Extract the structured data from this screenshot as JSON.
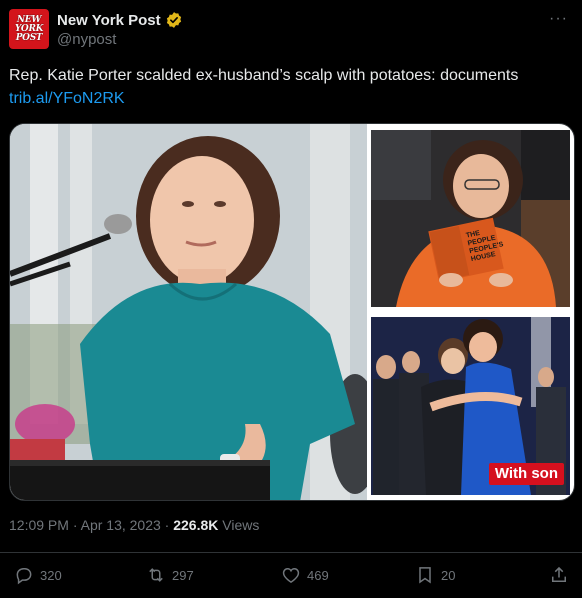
{
  "account": {
    "name": "New York Post",
    "handle": "@nypost",
    "avatar_lines": [
      "NEW",
      "YORK",
      "POST"
    ],
    "verified_color": "#e2b719"
  },
  "tweet": {
    "text": "Rep. Katie Porter scalded ex-husband’s scalp with potatoes: documents",
    "link": "trib.al/YFoN2RK"
  },
  "media": {
    "book_title_lines": [
      "THE",
      "PEOPLE",
      "PEOPLE'S",
      "HOUSE"
    ],
    "caption": "With son"
  },
  "meta": {
    "time": "12:09 PM",
    "separator1": " · ",
    "date": "Apr 13, 2023",
    "separator2": " · ",
    "views_count": "226.8K",
    "views_label": " Views"
  },
  "actions": {
    "replies": "320",
    "reposts": "297",
    "likes": "469",
    "bookmarks": "20"
  },
  "colors": {
    "background": "#000000",
    "text": "#e7e9ea",
    "muted": "#71767b",
    "link": "#1d9bf0",
    "brand_red": "#d3141b",
    "badge_red": "#d5101e"
  },
  "icons": {
    "more": "more-dots-icon",
    "reply": "reply-icon",
    "repost": "repost-icon",
    "like": "heart-icon",
    "bookmark": "bookmark-icon",
    "share": "share-icon"
  }
}
